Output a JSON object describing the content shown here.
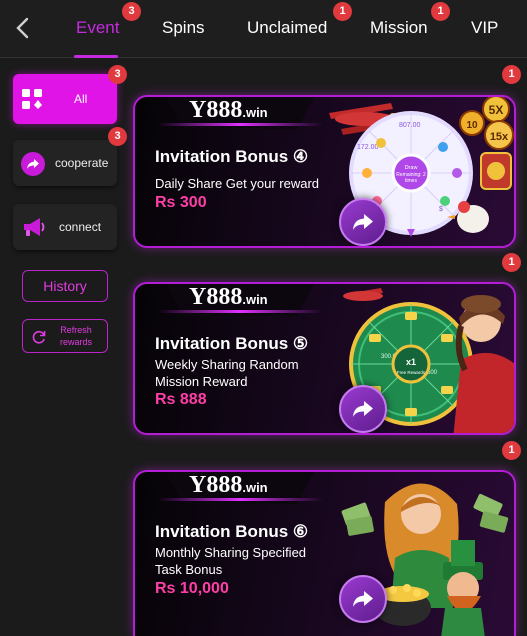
{
  "header": {
    "back_icon": "chevron-left-icon",
    "tabs": [
      {
        "label": "Event",
        "badge": "3",
        "active": true
      },
      {
        "label": "Spins",
        "badge": ""
      },
      {
        "label": "Unclaimed",
        "badge": "1"
      },
      {
        "label": "Mission",
        "badge": "1"
      },
      {
        "label": "VIP",
        "badge": ""
      }
    ]
  },
  "sidebar": {
    "categories": [
      {
        "label": "All",
        "badge": "3",
        "icon": "grid-icon",
        "active": true
      },
      {
        "label": "cooperate",
        "badge": "3",
        "icon": "share-icon"
      },
      {
        "label": "connect",
        "icon": "megaphone-icon"
      }
    ],
    "history_label": "History",
    "refresh_label": "Refresh rewards"
  },
  "banners": [
    {
      "badge": "1",
      "logo_main": "Y888",
      "logo_suffix": ".win",
      "title": "Invitation Bonus ④",
      "subtitle": "Daily Share  Get your reward",
      "amount": "Rs 300",
      "art": "fortune-wheel",
      "wheel_center": "Draw Remaining: 2 times"
    },
    {
      "badge": "1",
      "logo_main": "Y888",
      "logo_suffix": ".win",
      "title": "Invitation Bonus ⑤",
      "subtitle": "Weekly Sharing Random Mission Reward",
      "amount": "Rs 888",
      "art": "green-wheel",
      "wheel_center": "x1",
      "wheel_center_sub": "Free Rewards"
    },
    {
      "badge": "1",
      "logo_main": "Y888",
      "logo_suffix": ".win",
      "title": "Invitation Bonus ⑥",
      "subtitle": "Monthly Sharing Specified Task Bonus",
      "amount": "Rs 10,000",
      "art": "lucky-characters"
    }
  ],
  "colors": {
    "accent": "#e114e8",
    "badge": "#e0393e",
    "amount": "#ff3ea8",
    "background": "#1b1b1b"
  }
}
